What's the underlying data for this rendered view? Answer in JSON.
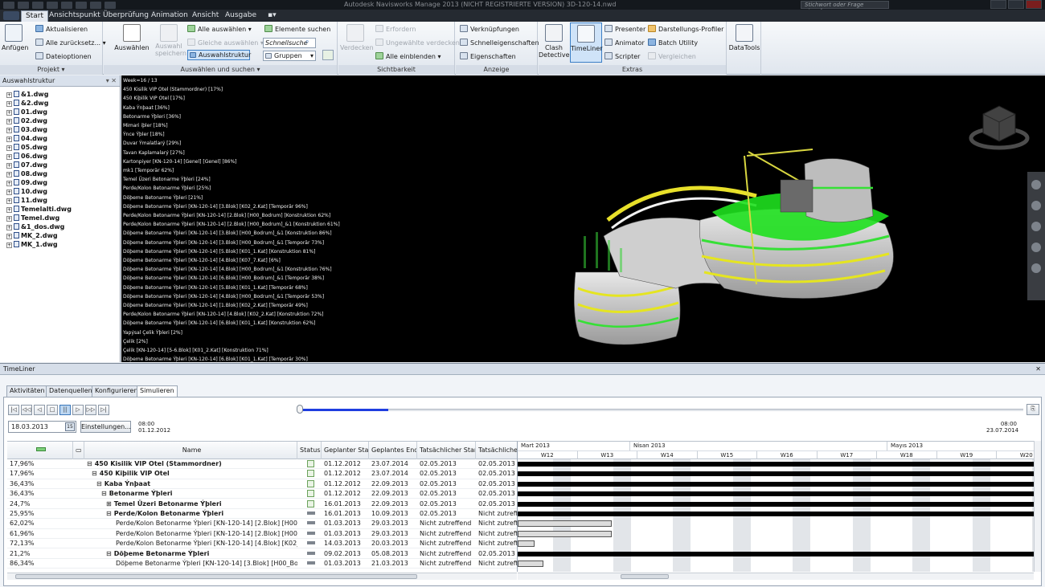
{
  "window": {
    "title": "Autodesk Navisworks Manage 2013 (NICHT REGISTRIERTE VERSION)   3D-120-14.nwd",
    "search_placeholder": "Stichwort oder Frage eingeben"
  },
  "ribbon_tabs": [
    "Start",
    "Ansichtspunkt",
    "Überprüfung",
    "Animation",
    "Ansicht",
    "Ausgabe"
  ],
  "ribbon": {
    "projekt": {
      "label": "Projekt",
      "anfugen": "Anfügen",
      "aktualisieren": "Aktualisieren",
      "alle_zuruck": "Alle zurücksetz...",
      "dateioptionen": "Dateioptionen"
    },
    "auswahl": {
      "label": "Auswählen und suchen",
      "auswahlen": "Auswählen",
      "auswahl_speichern": "Auswahl speichern",
      "alle_auswahlen": "Alle auswählen",
      "gleiche_auswahlen": "Gleiche auswählen",
      "auswahlstruktur": "Auswahlstruktur",
      "elemente_suchen": "Elemente suchen",
      "schnellsuche": "Schnellsuche",
      "gruppen": "Gruppen"
    },
    "sichtbarkeit": {
      "label": "Sichtbarkeit",
      "verdecken": "Verdecken",
      "erfordern": "Erfordern",
      "ungewahlte": "Ungewählte verdecken",
      "alle_einblenden": "Alle einblenden"
    },
    "anzeige": {
      "label": "Anzeige",
      "verknupfungen": "Verknüpfungen",
      "schnelleigenschaften": "Schnelleigenschaften",
      "eigenschaften": "Eigenschaften"
    },
    "extras": {
      "label": "Extras",
      "clash1": "Clash",
      "clash2": "Detective",
      "timeliner": "TimeLiner",
      "presenter": "Presenter",
      "animator": "Animator",
      "scripter": "Scripter",
      "darstellungs": "Darstellungs-Profiler",
      "batch": "Batch Utility",
      "vergleichen": "Vergleichen"
    },
    "datatools": {
      "label": "DataTools"
    }
  },
  "selection_tree": {
    "title": "Auswahlstruktur",
    "items": [
      "&1.dwg",
      "&2.dwg",
      "01.dwg",
      "02.dwg",
      "03.dwg",
      "04.dwg",
      "05.dwg",
      "06.dwg",
      "07.dwg",
      "08.dwg",
      "09.dwg",
      "10.dwg",
      "11.dwg",
      "Temelalti.dwg",
      "Temel.dwg",
      "&1_dos.dwg",
      "MK_2.dwg",
      "MK_1.dwg"
    ]
  },
  "viewport_overlay": [
    "Week=16 / 13",
    "450 Kisilik VIP Otel (Stammordner) [17%]",
    "450 Kiþilik VIP Otel [17%]",
    "Kaba Ýnþaat [36%]",
    "Betonarme Ýþleri [36%]",
    "Mimari iþler [18%]",
    "Ýnce Ýþler [18%]",
    "Duvar Ýmalatlarý [29%]",
    "Tavan Kaplamalarý [27%]",
    "Kartonpiyer [KN-120-14] [Genel] [Genel] [86%]",
    "mk1 [Temporär 62%]",
    "Temel Üzeri Betonarme Ýþleri [24%]",
    "Perde/Kolon Betonarme Ýþleri [25%]",
    "Döþeme Betonarme Ýþleri [21%]",
    "Döþeme Betonarme Ýþleri [KN-120-14] [3.Blok] [K02_2.Kat] [Temporär 96%]",
    "Perde/Kolon Betonarme Ýþleri [KN-120-14] [2.Blok] [H00_Bodrum] [Konstruktion 62%]",
    "Perde/Kolon Betonarme Ýþleri [KN-120-14] [2.Blok] [H00_Bodrum]_&1 [Konstruktion 61%]",
    "Döþeme Betonarme Ýþleri [KN-120-14] [3.Blok] [H00_Bodrum]_&1 [Konstruktion 86%]",
    "Döþeme Betonarme Ýþleri [KN-120-14] [3.Blok] [H00_Bodrum]_&1 [Temporär 73%]",
    "Döþeme Betonarme Ýþleri [KN-120-14] [5.Blok] [K01_1.Kat] [Konstruktion 81%]",
    "Döþeme Betonarme Ýþleri [KN-120-14] [4.Blok] [K07_7.Kat] [6%]",
    "Döþeme Betonarme Ýþleri [KN-120-14] [4.Blok] [H00_Bodrum]_&1 [Konstruktion 76%]",
    "Döþeme Betonarme Ýþleri [KN-120-14] [6.Blok] [H00_Bodrum]_&1 [Temporär 38%]",
    "Döþeme Betonarme Ýþleri [KN-120-14] [5.Blok] [K01_1.Kat] [Temporär 68%]",
    "Döþeme Betonarme Ýþleri [KN-120-14] [4.Blok] [H00_Bodrum]_&1 [Temporär 53%]",
    "Döþeme Betonarme Ýþleri [KN-120-14] [1.Blok] [K02_2.Kat] [Temporär 49%]",
    "Perde/Kolon Betonarme Ýþleri [KN-120-14] [4.Blok] [K02_2.Kat] [Konstruktion 72%]",
    "Döþeme Betonarme Ýþleri [KN-120-14] [6.Blok] [K01_1.Kat] [Konstruktion 62%]",
    "Yapýsal Çelik Ýþleri [2%]",
    "Çelik [2%]",
    "Çelik [KN-120-14] [5-6.Blok] [K01_2.Kat] [Konstruktion 71%]",
    "Döþeme Betonarme Ýþleri [KN-120-14] [6.Blok] [K01_1.Kat] [Temporär 30%]"
  ],
  "timeliner": {
    "title": "TimeLiner",
    "tabs": [
      "Aktivitäten",
      "Datenquellen",
      "Konfigurieren",
      "Simulieren"
    ],
    "current_date": "18.03.2013",
    "calendar_day": "15",
    "settings_label": "Einstellungen...",
    "start_time": "08:00",
    "start_date": "01.12.2012",
    "end_time": "08:00",
    "end_date": "23.07.2014",
    "playback_progress": 0.12,
    "columns": [
      "",
      "",
      "Name",
      "Status",
      "Geplanter Start",
      "Geplantes Ende",
      "Tatsächlicher Start",
      "Tatsächliches Ende"
    ],
    "rows": [
      {
        "pct": "17,96%",
        "name": "450 Kisilik VIP Otel (Stammordner)",
        "indent": 0,
        "bold": true,
        "tree": "⊟",
        "status": "check",
        "ps": "01.12.2012",
        "pe": "23.07.2014",
        "as": "02.05.2013",
        "ae": "02.05.2013"
      },
      {
        "pct": "17,96%",
        "name": "450 Kiþilik VIP Otel",
        "indent": 1,
        "bold": true,
        "tree": "⊟",
        "status": "check",
        "ps": "01.12.2012",
        "pe": "23.07.2014",
        "as": "02.05.2013",
        "ae": "02.05.2013"
      },
      {
        "pct": "36,43%",
        "name": "Kaba Ýnþaat",
        "indent": 2,
        "bold": true,
        "tree": "⊟",
        "status": "check",
        "ps": "01.12.2012",
        "pe": "22.09.2013",
        "as": "02.05.2013",
        "ae": "02.05.2013"
      },
      {
        "pct": "36,43%",
        "name": "Betonarme Ýþleri",
        "indent": 3,
        "bold": true,
        "tree": "⊟",
        "status": "check",
        "ps": "01.12.2012",
        "pe": "22.09.2013",
        "as": "02.05.2013",
        "ae": "02.05.2013"
      },
      {
        "pct": "24,7%",
        "name": "Temel Üzeri Betonarme Ýþleri",
        "indent": 4,
        "bold": true,
        "tree": "⊞",
        "status": "check",
        "ps": "16.01.2013",
        "pe": "22.09.2013",
        "as": "02.05.2013",
        "ae": "02.05.2013"
      },
      {
        "pct": "25,95%",
        "name": "Perde/Kolon Betonarme Ýþleri",
        "indent": 4,
        "bold": true,
        "tree": "⊟",
        "status": "bar",
        "ps": "16.01.2013",
        "pe": "10.09.2013",
        "as": "02.05.2013",
        "ae": "Nicht zutreffend"
      },
      {
        "pct": "62,02%",
        "name": "Perde/Kolon Betonarme Ýþleri [KN-120-14] [2.Blok] [H00_Bodrum]",
        "indent": 6,
        "bold": false,
        "tree": "",
        "status": "bar",
        "ps": "01.03.2013",
        "pe": "29.03.2013",
        "as": "Nicht zutreffend",
        "ae": "Nicht zutreffend"
      },
      {
        "pct": "61,96%",
        "name": "Perde/Kolon Betonarme Ýþleri [KN-120-14] [2.Blok] [H00_Bodrum]_&1",
        "indent": 6,
        "bold": false,
        "tree": "",
        "status": "bar",
        "ps": "01.03.2013",
        "pe": "29.03.2013",
        "as": "Nicht zutreffend",
        "ae": "Nicht zutreffend"
      },
      {
        "pct": "72,13%",
        "name": "Perde/Kolon Betonarme Ýþleri [KN-120-14] [4.Blok] [K02_2.Kat]",
        "indent": 6,
        "bold": false,
        "tree": "",
        "status": "bar",
        "ps": "14.03.2013",
        "pe": "20.03.2013",
        "as": "Nicht zutreffend",
        "ae": "Nicht zutreffend"
      },
      {
        "pct": "21,2%",
        "name": "Döþeme Betonarme Ýþleri",
        "indent": 4,
        "bold": true,
        "tree": "⊟",
        "status": "bar",
        "ps": "09.02.2013",
        "pe": "05.08.2013",
        "as": "Nicht zutreffend",
        "ae": "02.05.2013"
      },
      {
        "pct": "86,34%",
        "name": "Döþeme Betonarme Ýþleri [KN-120-14] [3.Blok] [H00_Bodrum]_&1",
        "indent": 6,
        "bold": false,
        "tree": "",
        "status": "bar",
        "ps": "01.03.2013",
        "pe": "21.03.2013",
        "as": "Nicht zutreffend",
        "ae": "Nicht zutreffend"
      }
    ],
    "gantt": {
      "months": [
        {
          "label": "Mart 2013"
        },
        {
          "label": "Nisan 2013"
        },
        {
          "label": "Mayıs 2013"
        }
      ],
      "weeks": [
        "W12",
        "W13",
        "W14",
        "W15",
        "W16",
        "W17",
        "W18",
        "W19",
        "W20"
      ]
    }
  },
  "colors": {
    "accent": "#1f3ee0",
    "viewport_bg": "#000000",
    "highlight_green": "#22e022",
    "highlight_yellow": "#e0e020"
  }
}
